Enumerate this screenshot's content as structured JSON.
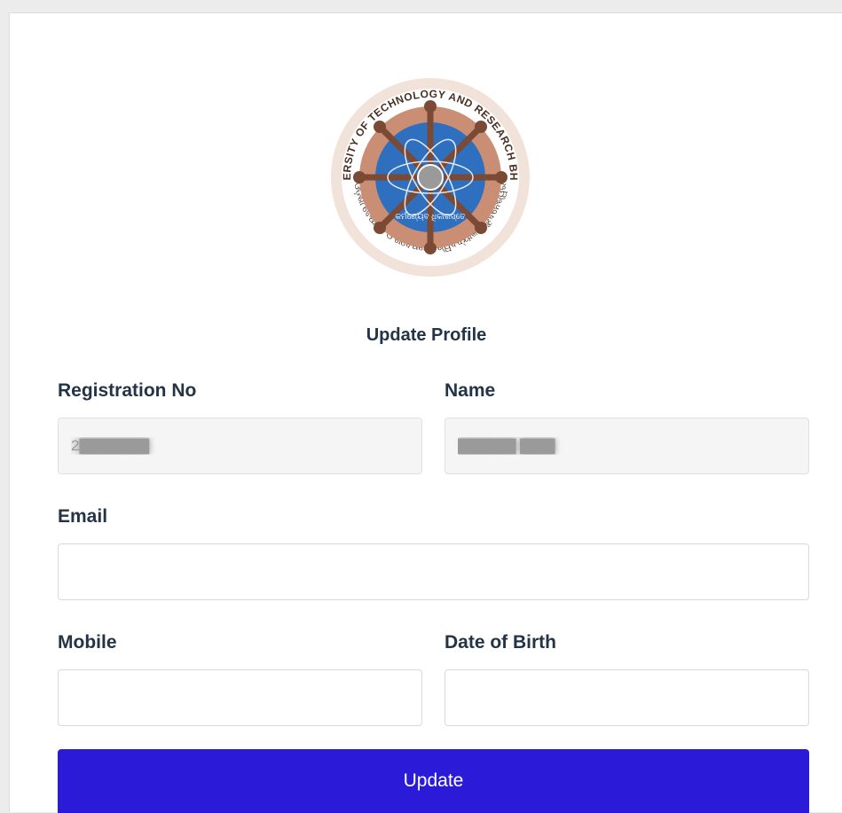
{
  "logo": {
    "ring_text_top": "ODISHA UNIVERSITY OF TECHNOLOGY AND RESEARCH BHUBANESWAR",
    "ring_text_bottom": "ଓଡ଼ିଶା ବୈଷୟିକ ଓ ଗବେଷଣା ବିଶ୍ୱବିଦ୍ୟାଳୟ ଭୁବନେଶ୍ୱର",
    "motto": "କର୍ମଣ୍ୟେବ ଧିକାରସ୍ତେ",
    "colors": {
      "outer_ring": "#c98e74",
      "inner_disc": "#2f6fc0",
      "spokes": "#7a4a35"
    }
  },
  "form": {
    "title": "Update Profile",
    "registration": {
      "label": "Registration No",
      "value": "2▇▇▇▇▇▇"
    },
    "name": {
      "label": "Name",
      "value": "▇▇▇▇▇ ▇▇▇"
    },
    "email": {
      "label": "Email",
      "value": ""
    },
    "mobile": {
      "label": "Mobile",
      "value": ""
    },
    "dob": {
      "label": "Date of Birth",
      "value": ""
    },
    "submit_label": "Update"
  },
  "colors": {
    "button": "#2b1bd9",
    "label_text": "#243447"
  }
}
